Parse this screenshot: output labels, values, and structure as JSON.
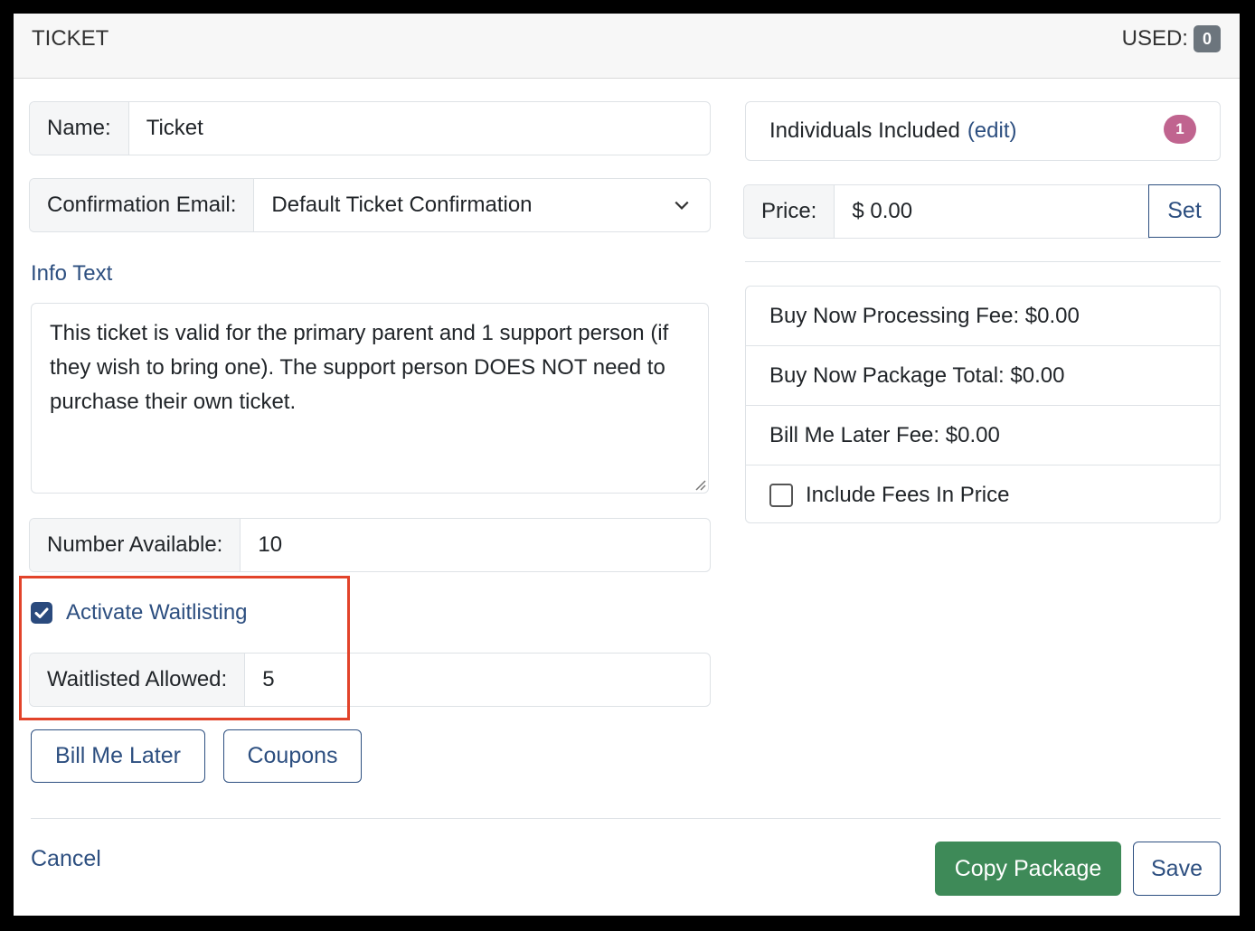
{
  "header": {
    "title": "TICKET",
    "used_label": "USED:",
    "used_count": "0"
  },
  "form": {
    "name_label": "Name:",
    "name_value": "Ticket",
    "confirmation_label": "Confirmation Email:",
    "confirmation_value": "Default Ticket Confirmation",
    "info_text_label": "Info Text",
    "info_text_value": "This ticket is valid for the primary parent and 1 support person (if they wish to bring one). The support person DOES NOT need to purchase their own ticket.",
    "number_available_label": "Number Available:",
    "number_available_value": "10",
    "waitlist_label": "Activate Waitlisting",
    "waitlist_checked": true,
    "waitlisted_allowed_label": "Waitlisted Allowed:",
    "waitlisted_allowed_value": "5",
    "bill_me_later_button": "Bill Me Later",
    "coupons_button": "Coupons"
  },
  "right": {
    "individuals_label": "Individuals Included",
    "individuals_edit": "(edit)",
    "individuals_count": "1",
    "price_label": "Price:",
    "price_value": "$ 0.00",
    "set_button": "Set",
    "fees": [
      "Buy Now Processing Fee: $0.00",
      "Buy Now Package Total: $0.00",
      "Bill Me Later Fee: $0.00"
    ],
    "include_fees_label": "Include Fees In Price",
    "include_fees_checked": false
  },
  "footer": {
    "cancel": "Cancel",
    "copy_package": "Copy Package",
    "save": "Save"
  },
  "colors": {
    "accent": "#2d4f80",
    "highlight": "#e2432a",
    "success": "#3e8a58",
    "badge_pink": "#c0648f",
    "badge_gray": "#6c757d"
  }
}
